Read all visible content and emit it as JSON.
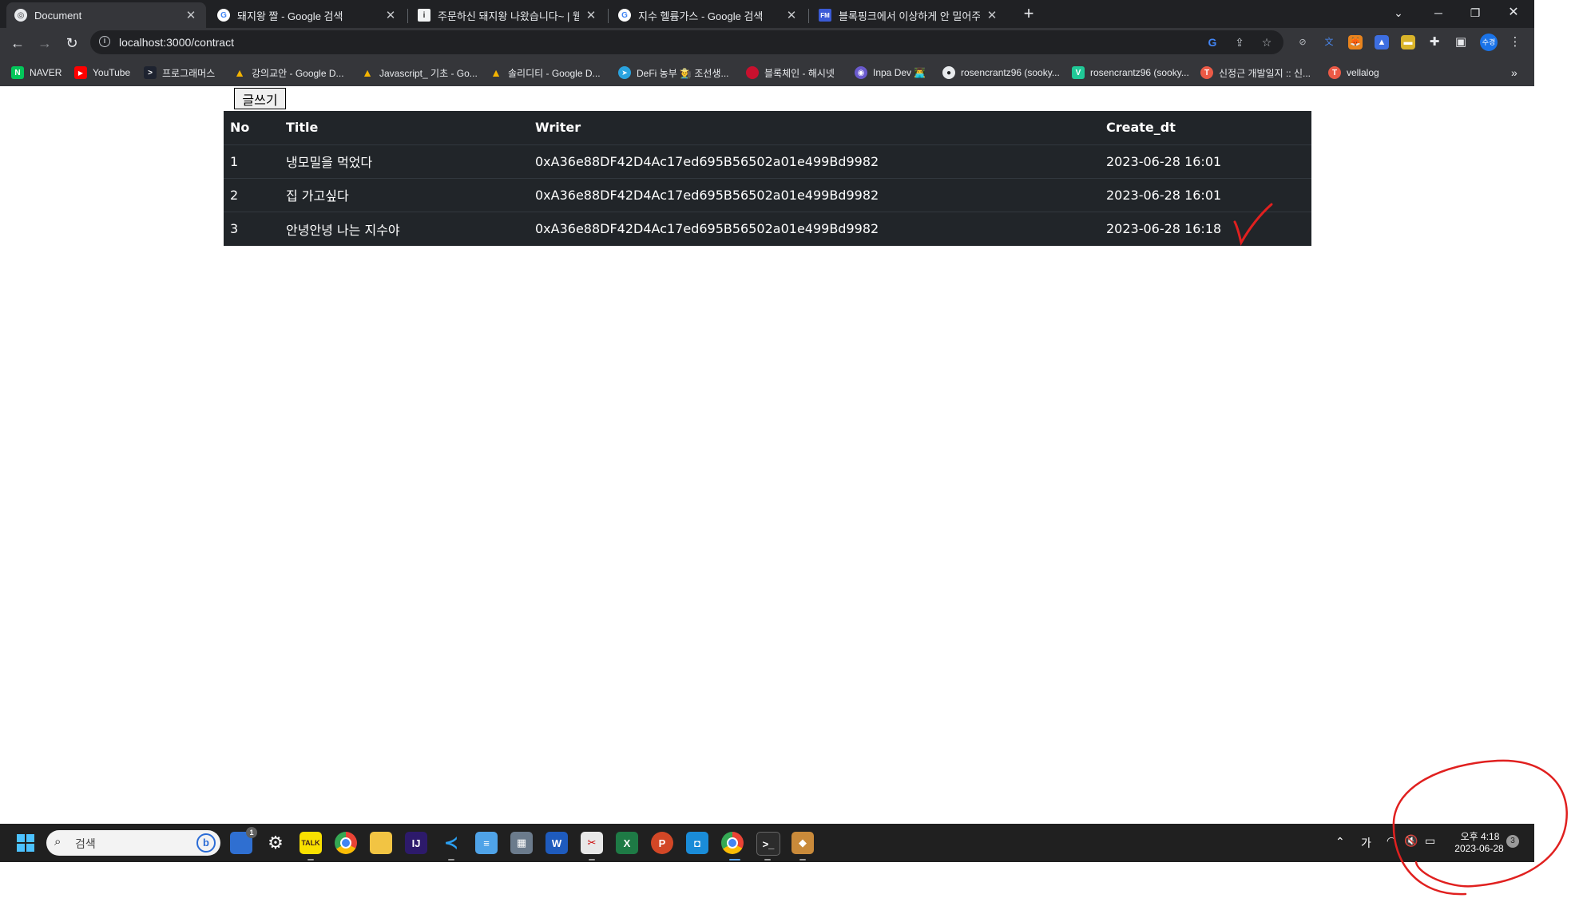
{
  "browser": {
    "tabs": [
      {
        "title": "Document",
        "active": true
      },
      {
        "title": "돼지왕 짤 - Google 검색",
        "active": false
      },
      {
        "title": "주문하신 돼지왕 나왔습니다~ | 웹",
        "active": false
      },
      {
        "title": "지수 헬륨가스 - Google 검색",
        "active": false
      },
      {
        "title": "블록핑크에서 이상하게 안 밀어주는",
        "active": false
      }
    ],
    "url": "localhost:3000/contract",
    "profile_label": "수경",
    "bookmarks": [
      {
        "label": "NAVER"
      },
      {
        "label": "YouTube"
      },
      {
        "label": "프로그래머스"
      },
      {
        "label": "강의교안 - Google D..."
      },
      {
        "label": "Javascript_ 기초 - Go..."
      },
      {
        "label": "솔리디티 - Google D..."
      },
      {
        "label": "DeFi 농부 🧑‍🌾 조선생..."
      },
      {
        "label": "블록체인 - 해시넷"
      },
      {
        "label": "Inpa Dev 👨‍💻"
      },
      {
        "label": "rosencrantz96 (sooky..."
      },
      {
        "label": "rosencrantz96 (sooky..."
      },
      {
        "label": "신정근 개발일지 :: 신..."
      },
      {
        "label": "vellalog"
      }
    ],
    "bookmarks_more": "»"
  },
  "page": {
    "write_button": "글쓰기",
    "table": {
      "headers": {
        "no": "No",
        "title": "Title",
        "writer": "Writer",
        "create_dt": "Create_dt"
      },
      "rows": [
        {
          "no": "1",
          "title": "냉모밀을 먹었다",
          "writer": "0xA36e88DF42D4Ac17ed695B56502a01e499Bd9982",
          "create_dt": "2023-06-28 16:01"
        },
        {
          "no": "2",
          "title": "집 가고싶다",
          "writer": "0xA36e88DF42D4Ac17ed695B56502a01e499Bd9982",
          "create_dt": "2023-06-28 16:01"
        },
        {
          "no": "3",
          "title": "안녕안녕 나는 지수야",
          "writer": "0xA36e88DF42D4Ac17ed695B56502a01e499Bd9982",
          "create_dt": "2023-06-28 16:18"
        }
      ]
    }
  },
  "taskbar": {
    "search_placeholder": "검색",
    "widgets_badge": "1",
    "ime_label": "가",
    "time": "오후 4:18",
    "date": "2023-06-28",
    "notification_count": "3"
  },
  "annotations": {
    "color": "#e0201f"
  }
}
